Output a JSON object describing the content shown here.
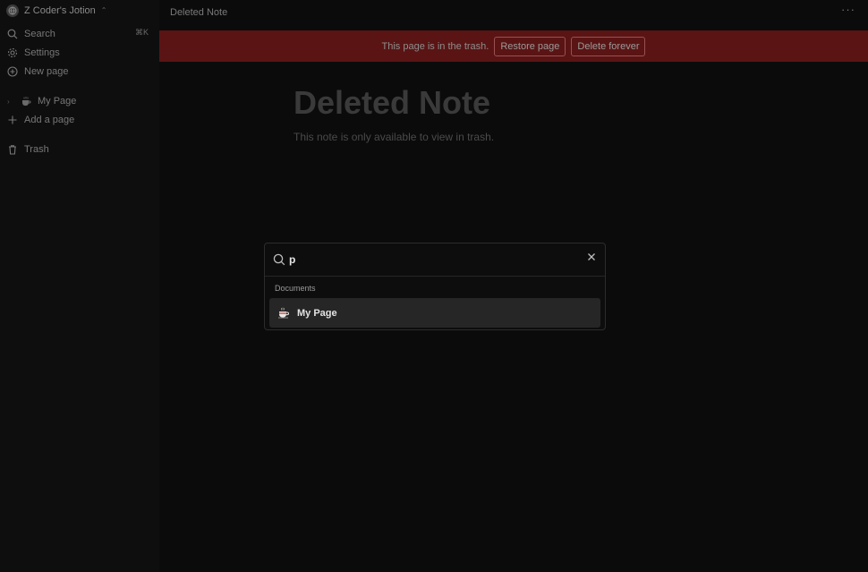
{
  "sidebar": {
    "workspace_name": "Z Coder's Jotion",
    "search_label": "Search",
    "search_shortcut": "⌘K",
    "settings_label": "Settings",
    "new_page_label": "New page",
    "pages": [
      {
        "title": "My Page",
        "icon": "coffee-cup-icon"
      }
    ],
    "add_page_label": "Add a page",
    "trash_label": "Trash"
  },
  "topbar": {
    "breadcrumb": "Deleted Note",
    "more_label": "···"
  },
  "banner": {
    "message": "This page is in the trash.",
    "restore_label": "Restore page",
    "delete_label": "Delete forever",
    "bg_color": "#5a1414"
  },
  "document": {
    "title": "Deleted Note",
    "subtitle": "This note is only available to view in trash."
  },
  "command_dialog": {
    "query": "p",
    "group_heading": "Documents",
    "results": [
      {
        "title": "My Page",
        "icon": "coffee-cup-icon"
      }
    ]
  }
}
